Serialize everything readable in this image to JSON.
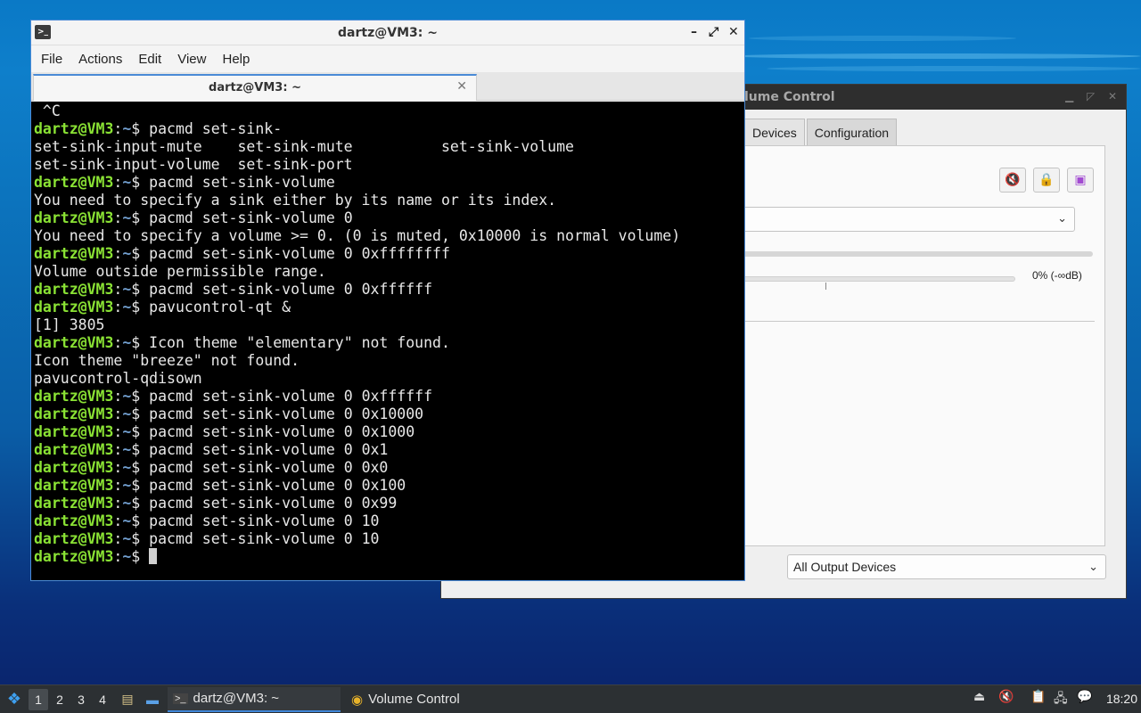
{
  "volume_control": {
    "title": "Volume Control",
    "title_visible": "lume Control",
    "tabs": [
      {
        "label": "Devices",
        "active": false
      },
      {
        "label": "Configuration",
        "active": false
      }
    ],
    "tab_devices_visible": "Devices",
    "buttons": {
      "mute_icon": "mute-icon",
      "lock_icon": "lock-icon",
      "default_icon": "set-default-icon"
    },
    "port_select_value": "",
    "volume_label": "0% (-∞dB)",
    "show_select_value": "All Output Devices"
  },
  "terminal": {
    "title": "dartz@VM3: ~",
    "tab_label": "dartz@VM3: ~",
    "menu": [
      "File",
      "Actions",
      "Edit",
      "View",
      "Help"
    ],
    "prompt_user": "dartz@VM3",
    "prompt_sep": ":",
    "prompt_path": "~",
    "prompt_symbol": "$ ",
    "lines": [
      {
        "type": "out",
        "text": " ^C"
      },
      {
        "type": "cmd",
        "text": "pacmd set-sink-"
      },
      {
        "type": "out",
        "text": "set-sink-input-mute    set-sink-mute          set-sink-volume"
      },
      {
        "type": "out",
        "text": "set-sink-input-volume  set-sink-port"
      },
      {
        "type": "cmd",
        "text": "pacmd set-sink-volume"
      },
      {
        "type": "out",
        "text": "You need to specify a sink either by its name or its index."
      },
      {
        "type": "cmd",
        "text": "pacmd set-sink-volume 0"
      },
      {
        "type": "out",
        "text": "You need to specify a volume >= 0. (0 is muted, 0x10000 is normal volume)"
      },
      {
        "type": "cmd",
        "text": "pacmd set-sink-volume 0 0xffffffff"
      },
      {
        "type": "out",
        "text": "Volume outside permissible range."
      },
      {
        "type": "cmd",
        "text": "pacmd set-sink-volume 0 0xffffff"
      },
      {
        "type": "cmd",
        "text": "pavucontrol-qt &"
      },
      {
        "type": "out",
        "text": "[1] 3805"
      },
      {
        "type": "cmd",
        "text": "Icon theme \"elementary\" not found."
      },
      {
        "type": "out",
        "text": "Icon theme \"breeze\" not found."
      },
      {
        "type": "out",
        "text": "pavucontrol-qdisown"
      },
      {
        "type": "cmd",
        "text": "pacmd set-sink-volume 0 0xffffff"
      },
      {
        "type": "cmd",
        "text": "pacmd set-sink-volume 0 0x10000"
      },
      {
        "type": "cmd",
        "text": "pacmd set-sink-volume 0 0x1000"
      },
      {
        "type": "cmd",
        "text": "pacmd set-sink-volume 0 0x1"
      },
      {
        "type": "cmd",
        "text": "pacmd set-sink-volume 0 0x0"
      },
      {
        "type": "cmd",
        "text": "pacmd set-sink-volume 0 0x100"
      },
      {
        "type": "cmd",
        "text": "pacmd set-sink-volume 0 0x99"
      },
      {
        "type": "cmd",
        "text": "pacmd set-sink-volume 0 10"
      },
      {
        "type": "cmd",
        "text": "pacmd set-sink-volume 0 10"
      },
      {
        "type": "prompt",
        "text": ""
      }
    ]
  },
  "taskbar": {
    "workspaces": [
      "1",
      "2",
      "3",
      "4"
    ],
    "active_workspace": "1",
    "tasks": [
      {
        "label": "dartz@VM3: ~",
        "active": true,
        "icon": "terminal-icon"
      },
      {
        "label": "Volume Control",
        "active": false,
        "icon": "volume-control-icon"
      }
    ],
    "clock": "18:20"
  },
  "colors": {
    "prompt_user": "#8ae234",
    "prompt_path": "#729fcf",
    "terminal_bg": "#000000",
    "accent": "#3f86d8"
  }
}
